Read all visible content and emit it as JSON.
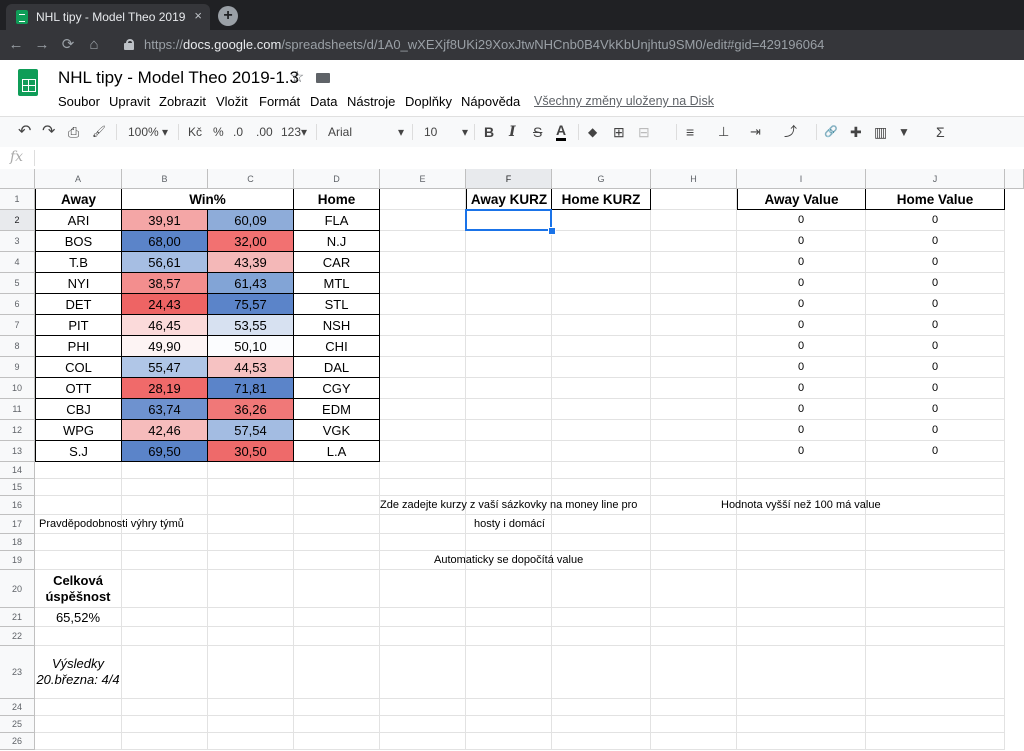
{
  "browser": {
    "tab_title": "NHL tipy - Model Theo 2019-1.3",
    "tab_close": "×",
    "new_tab": "+",
    "nav": {
      "back": "←",
      "forward": "→",
      "reload": "⟳",
      "home": "⌂"
    },
    "url_prefix": "https://",
    "url_host": "docs.google.com",
    "url_path": "/spreadsheets/d/1A0_wXEXjf8UKi29XoxJtwNHCnb0B4VkKbUnjhtu9SM0/edit#gid=429196064"
  },
  "doc": {
    "title": "NHL tipy - Model Theo 2019-1.3",
    "star": "☆",
    "menu": [
      "Soubor",
      "Upravit",
      "Zobrazit",
      "Vložit",
      "Formát",
      "Data",
      "Nástroje",
      "Doplňky",
      "Nápověda"
    ],
    "saved_status": "Všechny změny uloženy na Disk"
  },
  "toolbar": {
    "undo": "↶",
    "redo": "↷",
    "print": "⎙",
    "paint_format": "🖌",
    "zoom": "100%",
    "currency": "Kč",
    "percent": "%",
    "dec_less": ".0",
    "dec_more": ".00",
    "more_formats": "123",
    "font": "Arial",
    "font_size": "10",
    "bold": "B",
    "italic": "I",
    "strike": "S",
    "text_color": "A",
    "dropdown": "▾",
    "fill_icon": "◆",
    "borders_icon": "⊞",
    "merge_icon": "⊟",
    "align_icon": "≡",
    "valign_icon": "⊥",
    "wrap_icon": "⇥",
    "rotate_icon": "⤴",
    "link_icon": "🔗",
    "comment_icon": "✚",
    "chart_icon": "▥",
    "filter_icon": "▼",
    "functions": "Σ"
  },
  "formula_bar": {
    "fx": "fx",
    "value": ""
  },
  "columns": [
    "A",
    "B",
    "C",
    "D",
    "E",
    "F",
    "G",
    "H",
    "I",
    "J"
  ],
  "rows": [
    "1",
    "2",
    "3",
    "4",
    "5",
    "6",
    "7",
    "8",
    "9",
    "10",
    "11",
    "12",
    "13",
    "14",
    "15",
    "16",
    "17",
    "18",
    "19",
    "20",
    "21",
    "22",
    "23",
    "24",
    "25",
    "26"
  ],
  "headers": {
    "away": "Away",
    "win": "Win%",
    "home": "Home",
    "away_kurz": "Away KURZ",
    "home_kurz": "Home KURZ",
    "away_value": "Away Value",
    "home_value": "Home Value"
  },
  "matches": [
    {
      "away": "ARI",
      "pa": "39,91",
      "pb": "60,09",
      "home": "FLA",
      "av": "0",
      "hv": "0"
    },
    {
      "away": "BOS",
      "pa": "68,00",
      "pb": "32,00",
      "home": "N.J",
      "av": "0",
      "hv": "0"
    },
    {
      "away": "T.B",
      "pa": "56,61",
      "pb": "43,39",
      "home": "CAR",
      "av": "0",
      "hv": "0"
    },
    {
      "away": "NYI",
      "pa": "38,57",
      "pb": "61,43",
      "home": "MTL",
      "av": "0",
      "hv": "0"
    },
    {
      "away": "DET",
      "pa": "24,43",
      "pb": "75,57",
      "home": "STL",
      "av": "0",
      "hv": "0"
    },
    {
      "away": "PIT",
      "pa": "46,45",
      "pb": "53,55",
      "home": "NSH",
      "av": "0",
      "hv": "0"
    },
    {
      "away": "PHI",
      "pa": "49,90",
      "pb": "50,10",
      "home": "CHI",
      "av": "0",
      "hv": "0"
    },
    {
      "away": "COL",
      "pa": "55,47",
      "pb": "44,53",
      "home": "DAL",
      "av": "0",
      "hv": "0"
    },
    {
      "away": "OTT",
      "pa": "28,19",
      "pb": "71,81",
      "home": "CGY",
      "av": "0",
      "hv": "0"
    },
    {
      "away": "CBJ",
      "pa": "63,74",
      "pb": "36,26",
      "home": "EDM",
      "av": "0",
      "hv": "0"
    },
    {
      "away": "WPG",
      "pa": "42,46",
      "pb": "57,54",
      "home": "VGK",
      "av": "0",
      "hv": "0"
    },
    {
      "away": "S.J",
      "pa": "69,50",
      "pb": "30,50",
      "home": "L.A",
      "av": "0",
      "hv": "0"
    }
  ],
  "cell_colors": [
    [
      "#f4a6a6",
      "#8eacd9"
    ],
    [
      "#5b84c9",
      "#f27171"
    ],
    [
      "#a6bee3",
      "#f4b8b8"
    ],
    [
      "#f38e8e",
      "#82a4d6"
    ],
    [
      "#ee6464",
      "#5b84c9"
    ],
    [
      "#fbdada",
      "#d7e1f1"
    ],
    [
      "#fdf4f4",
      "#fbfcfe"
    ],
    [
      "#b0c6e7",
      "#f6c2c2"
    ],
    [
      "#f06a6a",
      "#5b84c9"
    ],
    [
      "#6e92cf",
      "#f07878"
    ],
    [
      "#f6bcbc",
      "#a3bce2"
    ],
    [
      "#5b84c9",
      "#ee6a6a"
    ]
  ],
  "notes": {
    "kurz_line1": "Zde zadejte kurzy z vaší sázkovky na money line pro",
    "kurz_line2": "hosty i domácí",
    "value_note": "Hodnota vyšší než 100 má value",
    "probabilities": "Pravděpodobnosti výhry týmů",
    "auto_value": "Automaticky se dopočítá value",
    "overall": "Celková úspěšnost",
    "overall_value": "65,52%",
    "results": "Výsledky 20.března: 4/4"
  },
  "colors": {
    "selection": "#1a73e8",
    "sheets_green": "#0f9d58"
  }
}
